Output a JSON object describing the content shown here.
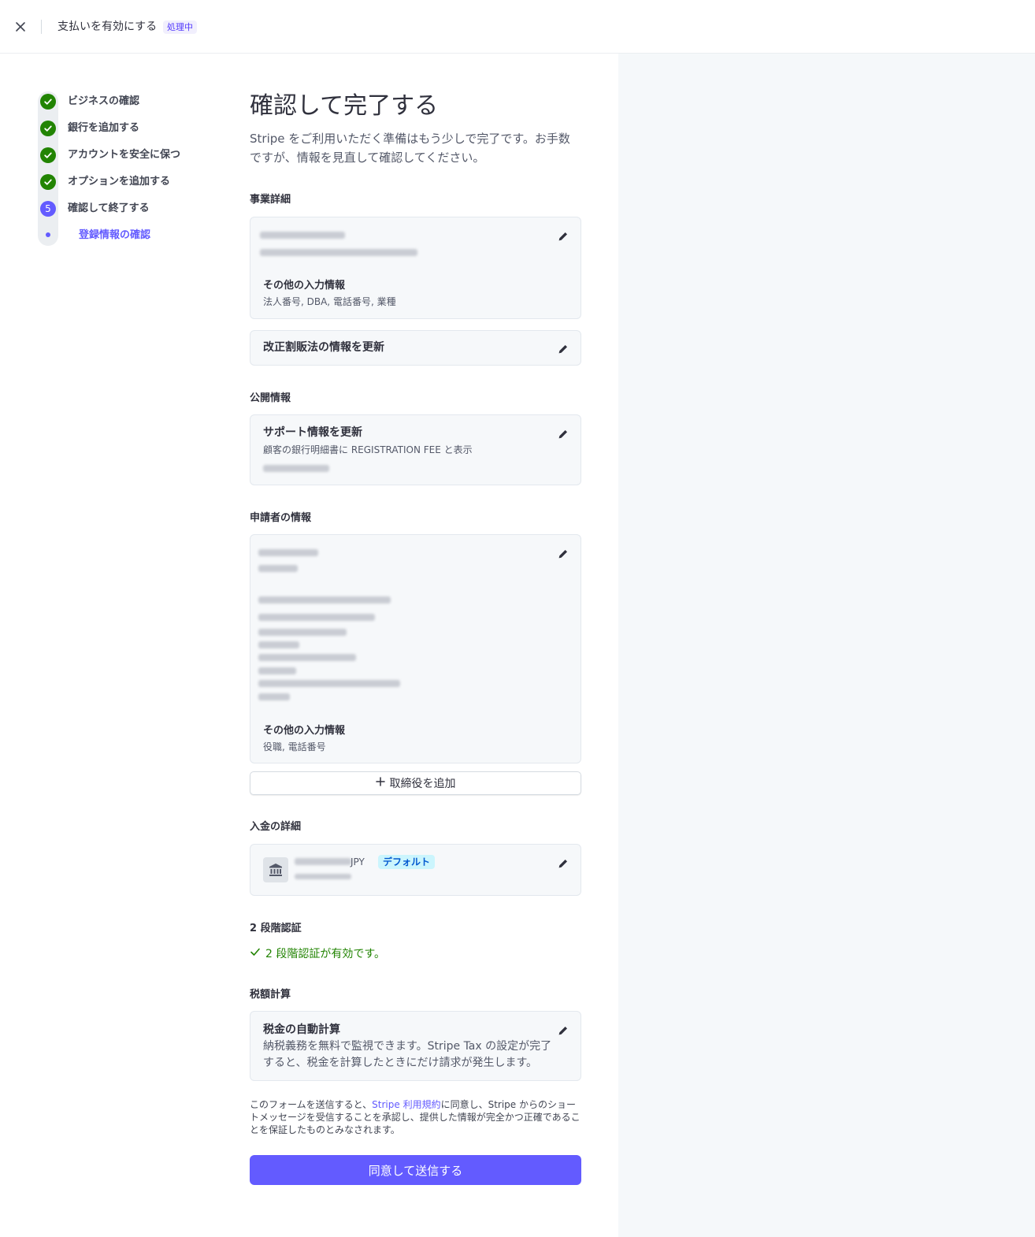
{
  "topbar": {
    "title": "支払いを有効にする",
    "status_badge": "処理中"
  },
  "steps": [
    {
      "label": "ビジネスの確認",
      "state": "done"
    },
    {
      "label": "銀行を追加する",
      "state": "done"
    },
    {
      "label": "アカウントを安全に保つ",
      "state": "done"
    },
    {
      "label": "オプションを追加する",
      "state": "done"
    },
    {
      "label": "確認して終了する",
      "state": "current",
      "number": "5"
    },
    {
      "label": "登録情報の確認",
      "state": "substep"
    }
  ],
  "main": {
    "heading": "確認して完了する",
    "intro": "Stripe をご利用いただく準備はもう少しで完了です。お手数ですが、情報を見直して確認してください。"
  },
  "business": {
    "section_title": "事業詳細",
    "other_info_label": "その他の入力情報",
    "other_info_value": "法人番号, DBA, 電話番号, 業種",
    "tokushoho_label": "改正割販法の情報を更新"
  },
  "public": {
    "section_title": "公開情報",
    "support_title": "サポート情報を更新",
    "statement_text": "顧客の銀行明細書に REGISTRATION FEE と表示"
  },
  "applicant": {
    "section_title": "申請者の情報",
    "other_info_label": "その他の入力情報",
    "other_info_value": "役職, 電話番号",
    "add_director_label": "取締役を追加"
  },
  "payout": {
    "section_title": "入金の詳細",
    "currency": "JPY",
    "default_badge": "デフォルト"
  },
  "twofa": {
    "section_title": "2 段階認証",
    "status_text": "2 段階認証が有効です。"
  },
  "tax": {
    "section_title": "税額計算",
    "title": "税金の自動計算",
    "description": "納税義務を無料で監視できます。Stripe Tax の設定が完了すると、税金を計算したときにだけ請求が発生します。"
  },
  "legal": {
    "text_before": "このフォームを送信すると、",
    "link_text": "Stripe 利用規約",
    "text_after": "に同意し、Stripe からのショートメッセージを受信することを承認し、提供した情報が完全かつ正確であることを保証したものとみなされます。"
  },
  "submit_label": "同意して送信する",
  "colors": {
    "accent": "#635bff",
    "success": "#228403",
    "panel_bg": "#f5f8fa"
  }
}
